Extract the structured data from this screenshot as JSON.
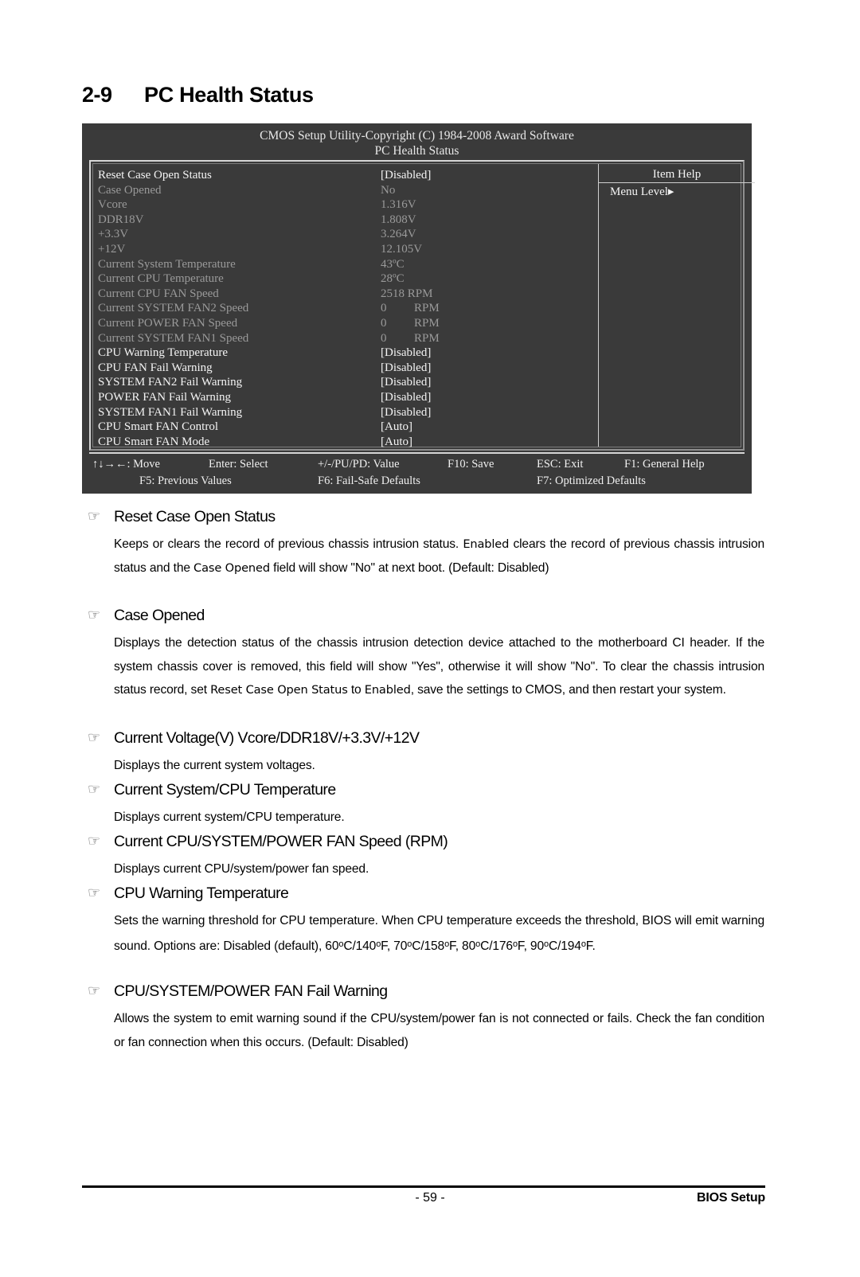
{
  "heading": {
    "number": "2-9",
    "title": "PC Health Status"
  },
  "bios": {
    "title_line1": "CMOS Setup Utility-Copyright (C) 1984-2008 Award Software",
    "title_line2": "PC Health Status",
    "rows": [
      {
        "label": "Reset Case Open Status",
        "value": "[Disabled]",
        "state": "lit"
      },
      {
        "label": "Case Opened",
        "value": "No",
        "state": "dim"
      },
      {
        "label": "Vcore",
        "value": "1.316V",
        "state": "dim"
      },
      {
        "label": "DDR18V",
        "value": "1.808V",
        "state": "dim"
      },
      {
        "label": "+3.3V",
        "value": "3.264V",
        "state": "dim"
      },
      {
        "label": "+12V",
        "value": "12.105V",
        "state": "dim"
      },
      {
        "label": "Current System Temperature",
        "value": "43ºC",
        "state": "dim"
      },
      {
        "label": "Current CPU Temperature",
        "value": "28ºC",
        "state": "dim"
      },
      {
        "label": "Current CPU FAN Speed",
        "value": "2518 RPM",
        "state": "dim"
      },
      {
        "label": "Current SYSTEM FAN2 Speed",
        "value": "0",
        "unit": "RPM",
        "state": "dim"
      },
      {
        "label": "Current POWER FAN Speed",
        "value": "0",
        "unit": "RPM",
        "state": "dim"
      },
      {
        "label": "Current SYSTEM FAN1 Speed",
        "value": "0",
        "unit": "RPM",
        "state": "dim"
      },
      {
        "label": "CPU Warning Temperature",
        "value": "[Disabled]",
        "state": "lit"
      },
      {
        "label": "CPU FAN Fail Warning",
        "value": "[Disabled]",
        "state": "lit"
      },
      {
        "label": "SYSTEM FAN2 Fail Warning",
        "value": "[Disabled]",
        "state": "lit"
      },
      {
        "label": "POWER FAN Fail Warning",
        "value": "[Disabled]",
        "state": "lit"
      },
      {
        "label": "SYSTEM FAN1 Fail Warning",
        "value": "[Disabled]",
        "state": "lit"
      },
      {
        "label": "CPU Smart FAN Control",
        "value": "[Auto]",
        "state": "lit"
      },
      {
        "label": "CPU Smart FAN Mode",
        "value": "[Auto]",
        "state": "lit"
      }
    ],
    "help": {
      "title": "Item Help",
      "menu_level": "Menu Level▸"
    },
    "footer": {
      "move": "↑↓→←: Move",
      "enter": "Enter: Select",
      "value": "+/-/PU/PD: Value",
      "save": "F10: Save",
      "exit": "ESC: Exit",
      "general_help": "F1: General Help",
      "previous": "F5: Previous Values",
      "failsafe": "F6: Fail-Safe Defaults",
      "optimized": "F7: Optimized Defaults"
    }
  },
  "sections": [
    {
      "hand": "☞",
      "title": "Reset Case Open Status",
      "body": "Keeps or clears the record of previous chassis intrusion status. <b>Enabled</b> clears the record of previous chassis intrusion status and the <b>Case Opened</b> field will show \"No\" at next boot. (Default: Disabled)"
    },
    {
      "hand": "☞",
      "title": "Case Opened",
      "body": "Displays the detection status of the chassis intrusion detection device attached to the motherboard CI header. If the system chassis cover is removed, this field will show \"Yes\", otherwise it will show \"No\". To clear the chassis intrusion status record, set <b>Reset Case Open Status</b> to <b>Enabled</b>, save the settings to CMOS, and then restart your system."
    },
    {
      "hand": "☞",
      "title": "Current Voltage(V) Vcore/DDR18V/+3.3V/+12V",
      "body": "Displays the current system voltages."
    },
    {
      "hand": "☞",
      "title": "Current System/CPU Temperature",
      "body": "Displays current system/CPU temperature."
    },
    {
      "hand": "☞",
      "title": "Current CPU/SYSTEM/POWER FAN Speed (RPM)",
      "body": "Displays current CPU/system/power fan speed."
    },
    {
      "hand": "☞",
      "title": "CPU Warning Temperature",
      "body": "Sets the warning threshold for CPU temperature. When CPU temperature exceeds the threshold, BIOS will emit warning sound. Options are: Disabled (default), 60<span class=\"deg\">o</span>C/140<span class=\"deg\">o</span>F, 70<span class=\"deg\">o</span>C/158<span class=\"deg\">o</span>F, 80<span class=\"deg\">o</span>C/176<span class=\"deg\">o</span>F, 90<span class=\"deg\">o</span>C/194<span class=\"deg\">o</span>F."
    },
    {
      "hand": "☞",
      "title": "CPU/SYSTEM/POWER FAN Fail Warning",
      "body": "Allows the system to emit warning sound if the CPU/system/power fan is not connected or fails. Check the fan condition or fan connection when this occurs. (Default: Disabled)"
    }
  ],
  "page_footer": {
    "page_number": "- 59 -",
    "right_label": "BIOS Setup"
  }
}
